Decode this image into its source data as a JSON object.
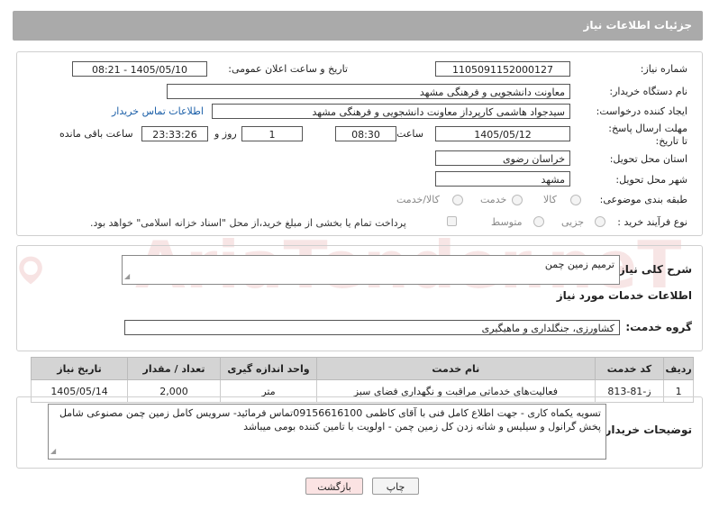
{
  "header": {
    "title": "جزئیات اطلاعات نیاز"
  },
  "form": {
    "need_number_label": "شماره نیاز:",
    "need_number": "1105091152000127",
    "announce_label": "تاریخ و ساعت اعلان عمومی:",
    "announce_value": "1405/05/10 - 08:21",
    "buyer_org_label": "نام دستگاه خریدار:",
    "buyer_org": "معاونت دانشجویی و فرهنگی مشهد",
    "creator_label": "ایجاد کننده درخواست:",
    "creator": "سیدجواد هاشمی کارپرداز معاونت دانشجویی و فرهنگی مشهد",
    "contact_link": "اطلاعات تماس خریدار",
    "deadline_label": "مهلت ارسال پاسخ: تا تاریخ:",
    "deadline_date": "1405/05/12",
    "time_label": "ساعت",
    "deadline_time": "08:30",
    "days_value": "1",
    "days_label": "روز و",
    "remaining_time": "23:33:26",
    "remaining_label": "ساعت باقی مانده",
    "province_label": "استان محل تحویل:",
    "province": "خراسان رضوی",
    "city_label": "شهر محل تحویل:",
    "city": "مشهد",
    "category_label": "طبقه بندی موضوعی:",
    "category_options": [
      "کالا",
      "خدمت",
      "کالا/خدمت"
    ],
    "process_label": "نوع فرآیند خرید :",
    "process_options": [
      "جزیی",
      "متوسط"
    ],
    "payment_note": "پرداخت تمام یا بخشی از مبلغ خرید،از محل \"اسناد خزانه اسلامی\" خواهد بود."
  },
  "description": {
    "label": "شرح کلی نیاز:",
    "value": "ترمیم زمین چمن"
  },
  "services": {
    "section_title": "اطلاعات خدمات مورد نیاز",
    "group_label": "گروه خدمت:",
    "group_value": "کشاورزی، جنگلداری و ماهیگیری",
    "columns": [
      "ردیف",
      "کد خدمت",
      "نام خدمت",
      "واحد اندازه گیری",
      "تعداد / مقدار",
      "تاریخ نیاز"
    ],
    "rows": [
      [
        "1",
        "ز-81-813",
        "فعالیت‌های خدماتی مراقبت و نگهداری فضای سبز",
        "متر",
        "2,000",
        "1405/05/14"
      ]
    ]
  },
  "buyer_notes": {
    "label": "توضیحات خریدار:",
    "value": "تسویه یکماه کاری - جهت اطلاع کامل فنی با آقای کاظمی 09156616100تماس فرمائید- سرویس کامل زمین چمن مصنوعی شامل پخش گرانول و سیلیس و شانه زدن کل زمین چمن - اولویت با تامین کننده بومی میباشد"
  },
  "buttons": {
    "print": "چاپ",
    "back": "بازگشت"
  },
  "colors": {
    "header_bg": "#aaaaaa",
    "link": "#1b5fa8",
    "back_button_bg": "#fbe3e3",
    "table_header_bg": "#d4d4d4"
  }
}
